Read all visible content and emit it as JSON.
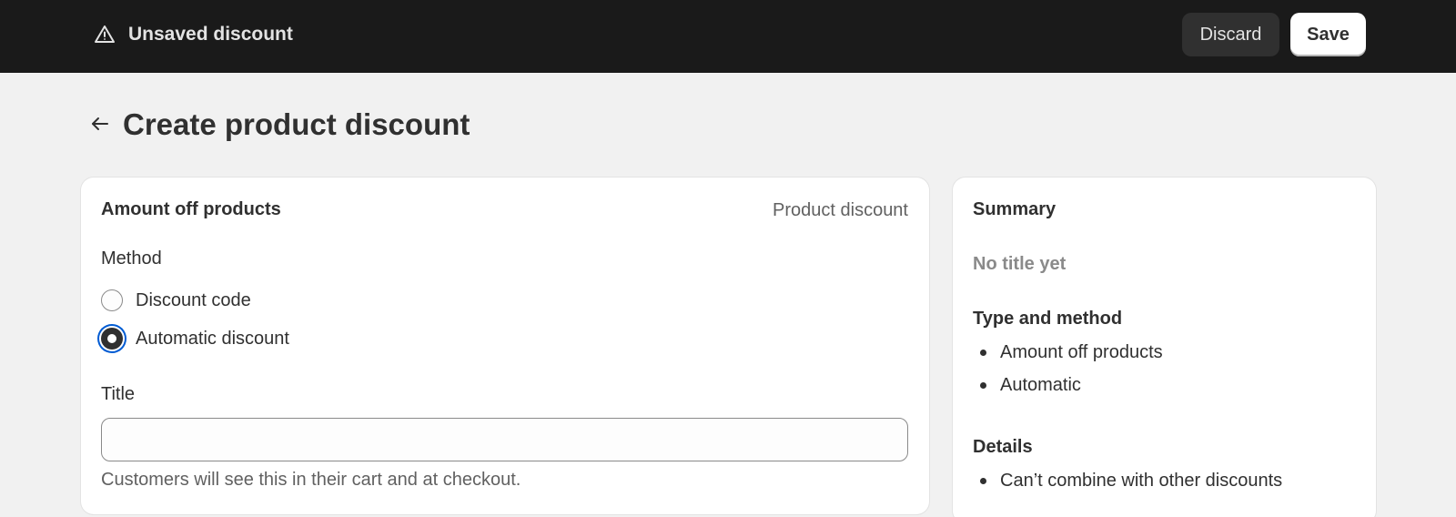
{
  "topbar": {
    "status_text": "Unsaved discount",
    "status_icon": "warning-triangle-icon",
    "discard_label": "Discard",
    "save_label": "Save"
  },
  "header": {
    "back_icon": "arrow-left-icon",
    "title": "Create product discount"
  },
  "main_card": {
    "heading": "Amount off products",
    "meta": "Product discount",
    "method": {
      "label": "Method",
      "options": [
        {
          "label": "Discount code",
          "selected": false
        },
        {
          "label": "Automatic discount",
          "selected": true
        }
      ]
    },
    "title_field": {
      "label": "Title",
      "value": "",
      "placeholder": "",
      "help": "Customers will see this in their cart and at checkout."
    }
  },
  "summary": {
    "heading": "Summary",
    "no_title": "No title yet",
    "type_method": {
      "heading": "Type and method",
      "items": [
        "Amount off products",
        "Automatic"
      ]
    },
    "details": {
      "heading": "Details",
      "items": [
        "Can’t combine with other discounts"
      ]
    }
  },
  "colors": {
    "topbar_bg": "#1a1a1a",
    "page_bg": "#f1f1f1",
    "focus_ring": "#005bd3"
  }
}
